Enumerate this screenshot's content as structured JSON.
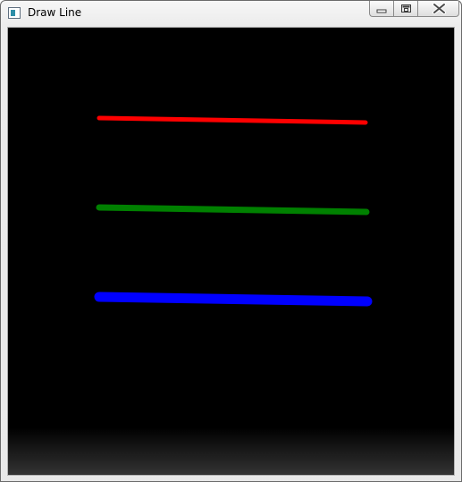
{
  "window": {
    "title": "Draw Line"
  },
  "controls": {
    "minimize_icon": "minimize-icon",
    "maximize_icon": "maximize-icon",
    "close_icon": "close-icon"
  },
  "canvas": {
    "background": "#000000",
    "lines": [
      {
        "name": "red-line",
        "color": "#ff0000"
      },
      {
        "name": "green-line",
        "color": "#008000"
      },
      {
        "name": "blue-line",
        "color": "#0000ff"
      }
    ]
  }
}
